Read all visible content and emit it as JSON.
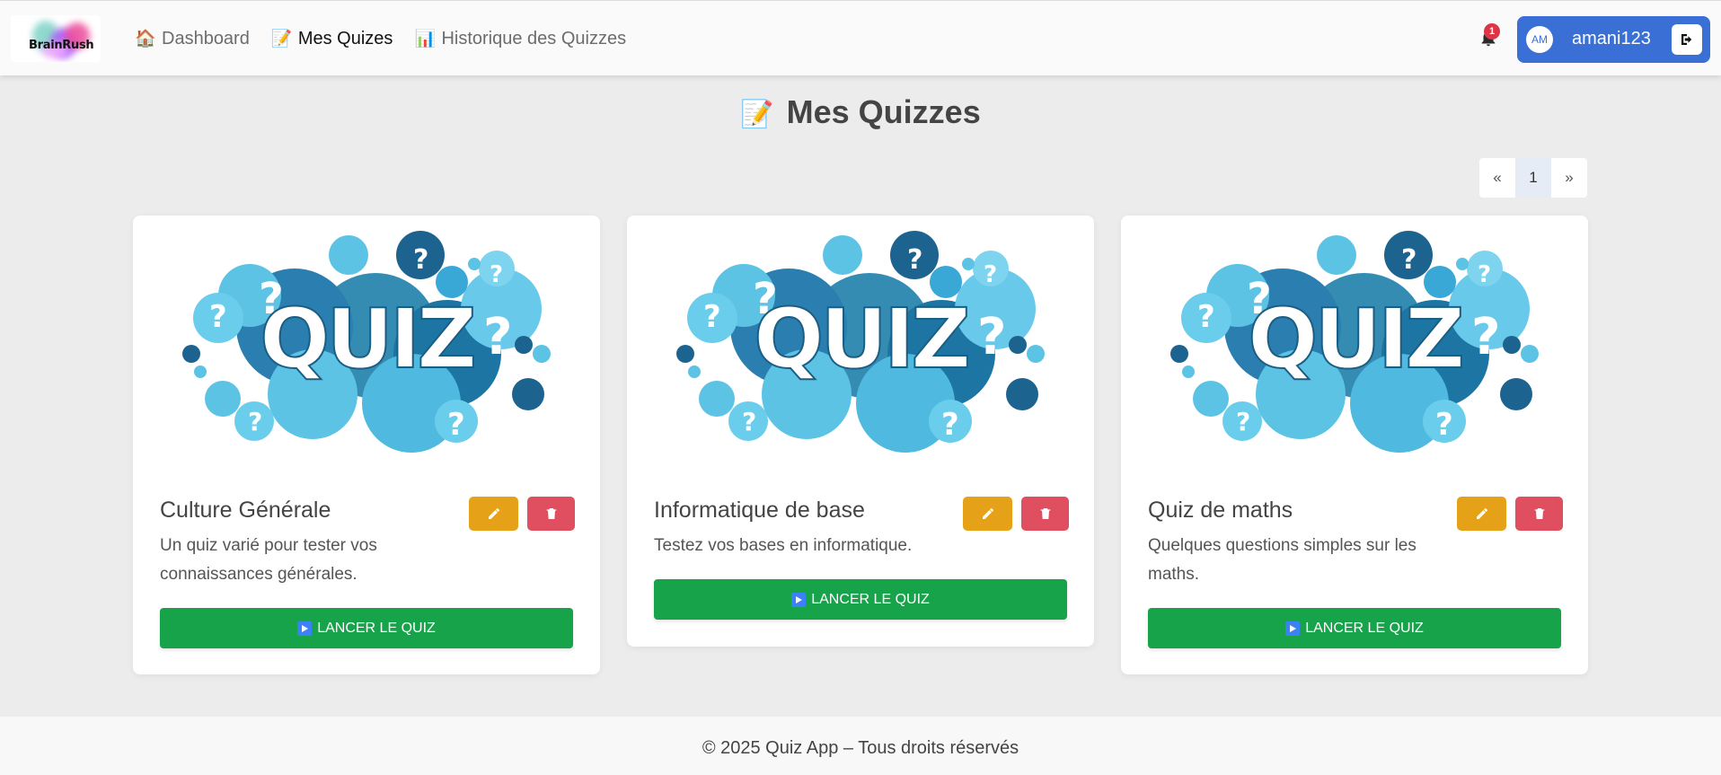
{
  "app": {
    "logo_text": "BrainRush"
  },
  "nav": {
    "items": [
      {
        "label": "Dashboard",
        "icon": "home-icon",
        "glyph": "🏠"
      },
      {
        "label": "Mes Quizes",
        "icon": "memo-icon",
        "glyph": "📝"
      },
      {
        "label": "Historique des Quizzes",
        "icon": "chart-icon",
        "glyph": "📊"
      }
    ],
    "notifications_count": "1",
    "user": {
      "initials": "AM",
      "username": "amani123"
    }
  },
  "main": {
    "title": "Mes Quizzes",
    "title_glyph": "📝",
    "pagination": {
      "prev": "«",
      "current": "1",
      "next": "»"
    },
    "quizzes": [
      {
        "title": "Culture Générale",
        "description": "Un quiz varié pour tester vos connaissances générales.",
        "image_word": "QUIZ",
        "launch_label": "LANCER LE QUIZ"
      },
      {
        "title": "Informatique de base",
        "description": "Testez vos bases en informatique.",
        "image_word": "QUIZ",
        "launch_label": "LANCER LE QUIZ"
      },
      {
        "title": "Quiz de maths",
        "description": "Quelques questions simples sur les maths.",
        "image_word": "QUIZ",
        "launch_label": "LANCER LE QUIZ"
      }
    ]
  },
  "footer": {
    "text": "© 2025 Quiz App – Tous droits réservés"
  },
  "colors": {
    "brand_blue": "#3a6fd6",
    "edit": "#e5a117",
    "delete": "#e04f5f",
    "launch": "#16a34a",
    "badge": "#dc3545"
  }
}
